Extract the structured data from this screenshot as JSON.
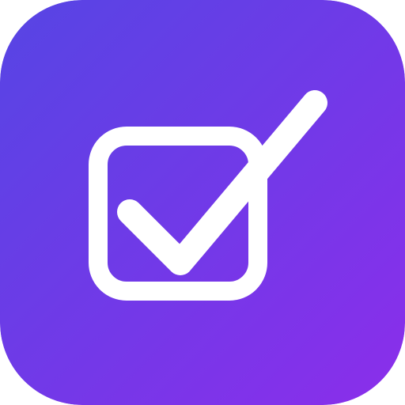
{
  "icon": {
    "name": "checkbox-checked-icon",
    "colors": {
      "gradient_start": "#5645E4",
      "gradient_end": "#8B2EEB",
      "glyph": "#FFFFFF"
    }
  }
}
